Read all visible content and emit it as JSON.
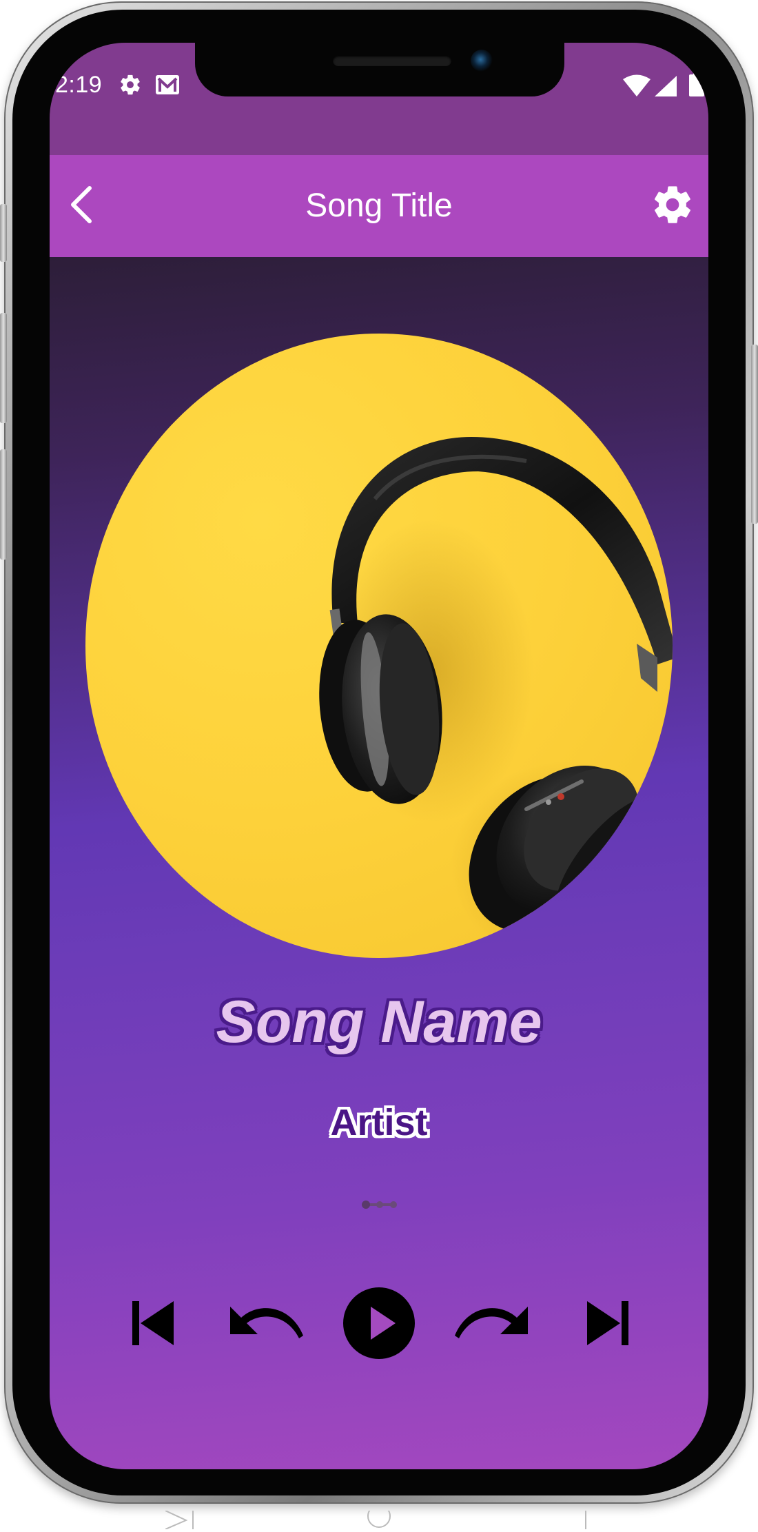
{
  "status_bar": {
    "time": "2:19",
    "icons": [
      "settings-icon",
      "gmail-icon",
      "wifi-icon",
      "signal-icon",
      "battery-icon"
    ]
  },
  "app_bar": {
    "title": "Song Title",
    "back_icon": "chevron-left-icon",
    "settings_icon": "gear-icon"
  },
  "player": {
    "song_name": "Song Name",
    "artist": "Artist",
    "album_art": "headphones-on-yellow",
    "controls": [
      "skip-previous-icon",
      "rewind-icon",
      "play-icon",
      "fast-forward-icon",
      "skip-next-icon"
    ]
  },
  "colors": {
    "status_bar": "#813b8f",
    "app_bar": "#ac48bf",
    "song_name_fill": "#e7c6ee",
    "song_name_stroke": "#4a1b8a",
    "artist_fill": "#4a1586",
    "accent_yellow": "#fdd13a"
  }
}
